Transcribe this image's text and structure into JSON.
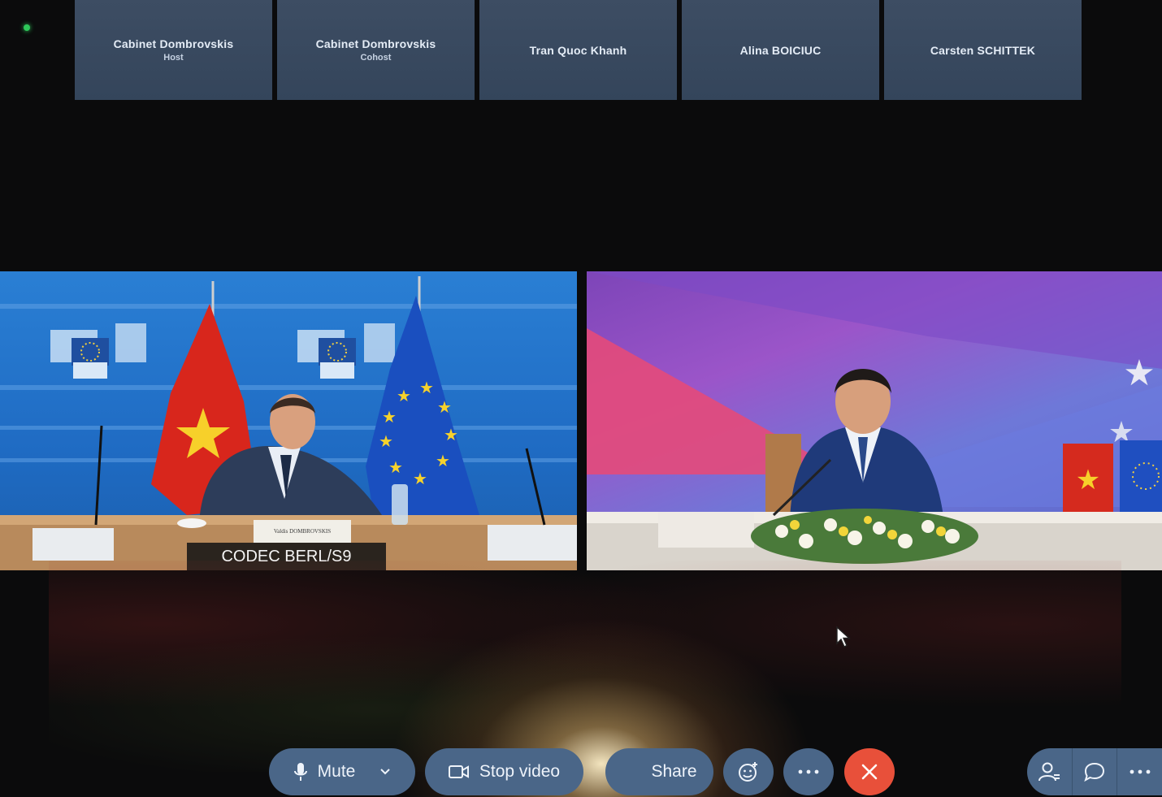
{
  "meeting": {
    "status_indicator": "connected",
    "status_color": "#2ec95a"
  },
  "participants_strip": [
    {
      "name": "Cabinet Dombrovskis",
      "role": "Host"
    },
    {
      "name": "Cabinet Dombrovskis",
      "role": "Cohost"
    },
    {
      "name": "Tran Quoc Khanh",
      "role": ""
    },
    {
      "name": "Alina BOICIUC",
      "role": ""
    },
    {
      "name": "Carsten SCHITTEK",
      "role": ""
    }
  ],
  "videos": {
    "left": {
      "feed_label": "CODEC BERL/S9",
      "nameplate": "Valdis DOMBROVSKIS"
    },
    "right": {
      "feed_label": ""
    }
  },
  "toolbar": {
    "mute_label": "Mute",
    "stop_video_label": "Stop video",
    "share_label": "Share",
    "reactions_icon": "smiley-icon",
    "more_icon": "ellipsis-icon",
    "end_icon": "close-icon",
    "participants_icon": "participants-icon",
    "chat_icon": "chat-icon",
    "more_right_icon": "ellipsis-icon"
  },
  "colors": {
    "toolbar": "#4a6688",
    "end_call": "#e8503a",
    "tile": "#3d4d63"
  }
}
